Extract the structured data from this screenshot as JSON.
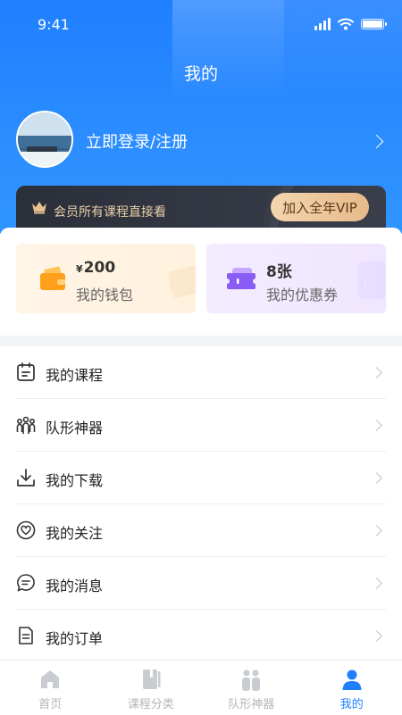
{
  "status_bar": {
    "time": "9:41",
    "signal_icon": "cellular-signal-icon",
    "wifi_icon": "wifi-icon",
    "battery_icon": "battery-icon"
  },
  "header": {
    "title": "我的"
  },
  "profile": {
    "login_label": "立即登录/注册",
    "avatar_icon": "avatar"
  },
  "vip": {
    "tagline": "会员所有课程直接看",
    "button_label": "加入全年VIP",
    "crown_icon": "crown-icon"
  },
  "assets": {
    "wallet": {
      "currency": "¥",
      "amount": "200",
      "label": "我的钱包",
      "icon": "wallet-icon"
    },
    "coupon": {
      "amount": "8张",
      "label": "我的优惠券",
      "icon": "ticket-icon"
    }
  },
  "menu": {
    "items": [
      {
        "label": "我的课程",
        "icon": "course-calendar-icon"
      },
      {
        "label": "队形神器",
        "icon": "group-people-icon"
      },
      {
        "label": "我的下载",
        "icon": "download-icon"
      },
      {
        "label": "我的关注",
        "icon": "heart-icon"
      },
      {
        "label": "我的消息",
        "icon": "message-icon"
      },
      {
        "label": "我的订单",
        "icon": "order-document-icon"
      }
    ]
  },
  "tabbar": {
    "tabs": [
      {
        "label": "首页",
        "icon": "home-icon",
        "active": false
      },
      {
        "label": "课程分类",
        "icon": "book-icon",
        "active": false
      },
      {
        "label": "队形神器",
        "icon": "formation-people-icon",
        "active": false
      },
      {
        "label": "我的",
        "icon": "person-icon",
        "active": true
      }
    ]
  },
  "colors": {
    "accent": "#1f7fff",
    "vip_gold": "#e9cfa8",
    "inactive_tab": "#b3b6bb"
  }
}
